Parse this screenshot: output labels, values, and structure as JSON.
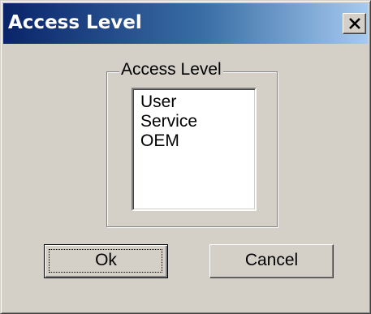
{
  "window": {
    "title": "Access Level",
    "close_icon": "close-icon"
  },
  "group": {
    "label": "Access Level"
  },
  "list": {
    "items": [
      "User",
      "Service",
      "OEM"
    ]
  },
  "buttons": {
    "ok_label": "Ok",
    "cancel_label": "Cancel"
  },
  "colors": {
    "face": "#d4d0c8",
    "title_start": "#0a246a",
    "title_end": "#a6caf0"
  }
}
